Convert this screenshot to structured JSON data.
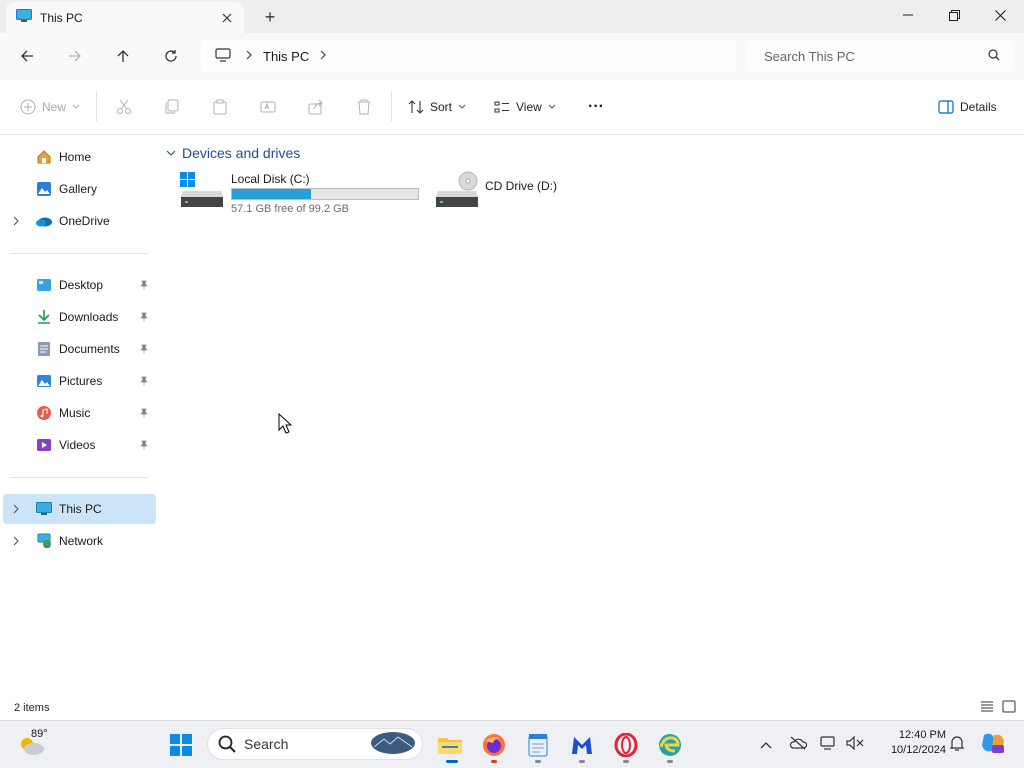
{
  "window": {
    "tab_title": "This PC",
    "new_tab": "+"
  },
  "nav": {
    "breadcrumb": [
      "This PC"
    ],
    "search_placeholder": "Search This PC"
  },
  "toolbar": {
    "new_label": "New",
    "sort_label": "Sort",
    "view_label": "View",
    "more_label": "···",
    "details_label": "Details"
  },
  "sidebar": {
    "quick": [
      {
        "label": "Home",
        "icon": "home-icon"
      },
      {
        "label": "Gallery",
        "icon": "gallery-icon"
      },
      {
        "label": "OneDrive",
        "icon": "onedrive-icon"
      }
    ],
    "pinned": [
      {
        "label": "Desktop",
        "icon": "desktop-icon"
      },
      {
        "label": "Downloads",
        "icon": "downloads-icon"
      },
      {
        "label": "Documents",
        "icon": "documents-icon"
      },
      {
        "label": "Pictures",
        "icon": "pictures-icon"
      },
      {
        "label": "Music",
        "icon": "music-icon"
      },
      {
        "label": "Videos",
        "icon": "videos-icon"
      }
    ],
    "locations": [
      {
        "label": "This PC",
        "icon": "this-pc-icon",
        "selected": true
      },
      {
        "label": "Network",
        "icon": "network-icon"
      }
    ]
  },
  "content": {
    "group_title": "Devices and drives",
    "drives": [
      {
        "name": "Local Disk (C:)",
        "free_text": "57.1 GB free of 99.2 GB",
        "free_gb": 57.1,
        "total_gb": 99.2
      },
      {
        "name": "CD Drive (D:)"
      }
    ]
  },
  "status": {
    "items": "2 items"
  },
  "taskbar": {
    "weather_temp": "89°",
    "search_label": "Search",
    "time": "12:40 PM",
    "date": "10/12/2024"
  },
  "colors": {
    "accent": "#0067c0",
    "drive_bar": "#26a0da",
    "selected_bg": "#cce4f7"
  }
}
